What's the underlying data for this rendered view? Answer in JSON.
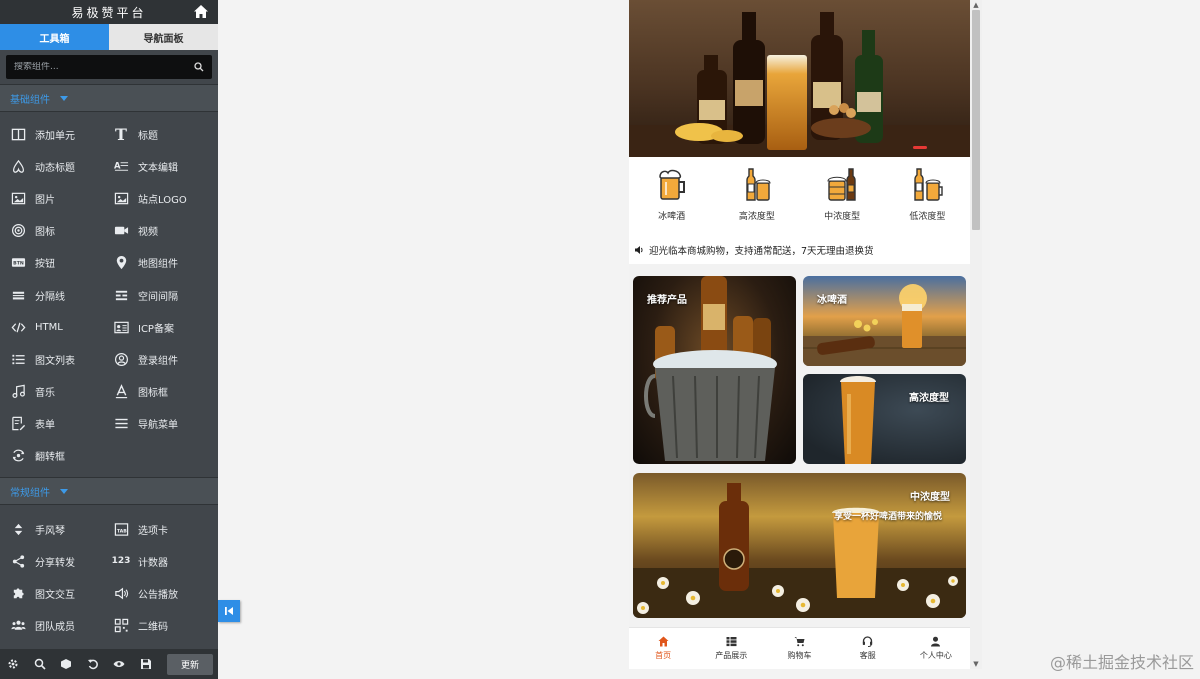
{
  "panel": {
    "title": "易极赞平台",
    "tabs": [
      {
        "label": "工具箱",
        "active": true
      },
      {
        "label": "导航面板",
        "active": false
      }
    ],
    "search": {
      "placeholder": "搜索组件..."
    },
    "sections": [
      {
        "title": "基础组件",
        "items": [
          {
            "label": "添加单元",
            "icon": "layout-column-icon"
          },
          {
            "label": "标题",
            "icon": "title-t-icon"
          },
          {
            "label": "动态标题",
            "icon": "dynamic-title-icon"
          },
          {
            "label": "文本编辑",
            "icon": "text-edit-icon"
          },
          {
            "label": "图片",
            "icon": "image-icon"
          },
          {
            "label": "站点LOGO",
            "icon": "site-logo-icon"
          },
          {
            "label": "图标",
            "icon": "target-icon"
          },
          {
            "label": "视频",
            "icon": "video-camera-icon"
          },
          {
            "label": "按钮",
            "icon": "button-btn-icon"
          },
          {
            "label": "地图组件",
            "icon": "map-marker-icon"
          },
          {
            "label": "分隔线",
            "icon": "divider-icon"
          },
          {
            "label": "空间间隔",
            "icon": "spacing-icon"
          },
          {
            "label": "HTML",
            "icon": "code-icon"
          },
          {
            "label": "ICP备案",
            "icon": "id-card-icon"
          },
          {
            "label": "图文列表",
            "icon": "list-icon"
          },
          {
            "label": "登录组件",
            "icon": "user-circle-icon"
          },
          {
            "label": "音乐",
            "icon": "music-icon"
          },
          {
            "label": "图标框",
            "icon": "font-a-icon"
          },
          {
            "label": "表单",
            "icon": "form-icon"
          },
          {
            "label": "导航菜单",
            "icon": "hamburger-menu-icon"
          },
          {
            "label": "翻转框",
            "icon": "flip-icon"
          }
        ]
      },
      {
        "title": "常规组件",
        "items": [
          {
            "label": "手风琴",
            "icon": "accordion-icon"
          },
          {
            "label": "选项卡",
            "icon": "tab-icon"
          },
          {
            "label": "分享转发",
            "icon": "share-icon"
          },
          {
            "label": "计数器",
            "icon": "counter-icon"
          },
          {
            "label": "图文交互",
            "icon": "puzzle-icon"
          },
          {
            "label": "公告播放",
            "icon": "speaker-icon"
          },
          {
            "label": "团队成员",
            "icon": "team-icon"
          },
          {
            "label": "二维码",
            "icon": "qrcode-icon"
          }
        ]
      }
    ],
    "update_label": "更新",
    "toolbar_icons": [
      "settings-icon",
      "search-icon",
      "cube-icon",
      "undo-icon",
      "eye-icon",
      "save-icon"
    ]
  },
  "preview": {
    "categories": [
      {
        "label": "冰啤酒",
        "icon": "beer-mug-icon"
      },
      {
        "label": "高浓度型",
        "icon": "beer-bottle-icon"
      },
      {
        "label": "中浓度型",
        "icon": "beer-keg-icon"
      },
      {
        "label": "低浓度型",
        "icon": "beer-cheers-icon"
      }
    ],
    "notice": "迎光临本商城购物，支持通常配送，7天无理由退换货",
    "cards": {
      "recommended": "推荐产品",
      "cold_beer": "冰啤酒",
      "high_strength": "高浓度型",
      "medium_strength": "中浓度型",
      "medium_strength_sub": "享受一杯好啤酒带来的愉悦"
    },
    "tabbar": [
      {
        "label": "首页",
        "icon": "home-icon",
        "active": true
      },
      {
        "label": "产品展示",
        "icon": "grid-icon",
        "active": false
      },
      {
        "label": "购物车",
        "icon": "cart-icon",
        "active": false
      },
      {
        "label": "客服",
        "icon": "headset-icon",
        "active": false
      },
      {
        "label": "个人中心",
        "icon": "person-icon",
        "active": false
      }
    ]
  },
  "watermark": "@稀土掘金技术社区",
  "colors": {
    "accent": "#2e8ee6",
    "panel_bg": "#41464b",
    "active_tab": "#e0561b"
  }
}
